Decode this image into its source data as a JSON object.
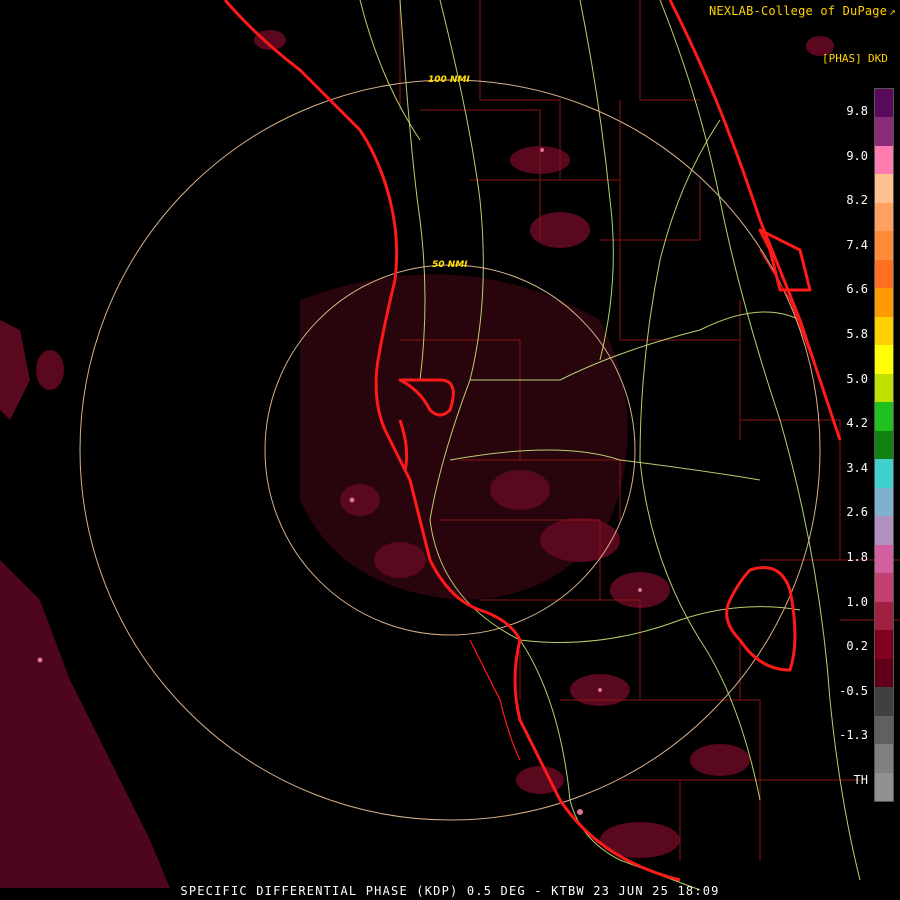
{
  "header": {
    "credit": "NEXLAB-College of DuPage",
    "credit_icon": "external-link-icon"
  },
  "legend": {
    "unit": "[PHAS]",
    "title": "DKD",
    "ticks": [
      "9.8",
      "9.0",
      "8.2",
      "7.4",
      "6.6",
      "5.8",
      "5.0",
      "4.2",
      "3.4",
      "2.6",
      "1.8",
      "1.0",
      "0.2",
      "-0.5",
      "-1.3",
      "TH"
    ],
    "colors": [
      "#5a0a5a",
      "#8c2a7a",
      "#ff7bb0",
      "#ffc090",
      "#ffa060",
      "#ff8a3a",
      "#ff7020",
      "#ff9a00",
      "#ffd000",
      "#ffff00",
      "#c0e000",
      "#20c020",
      "#108010",
      "#40d0d0",
      "#80b0d0",
      "#b090c0",
      "#d060a0",
      "#c04070",
      "#a02040",
      "#800020",
      "#600018",
      "#404040",
      "#606060",
      "#808080",
      "#909090"
    ]
  },
  "rings": {
    "inner_label": "50 NMI",
    "outer_label": "100 NMI"
  },
  "footer": {
    "caption": "SPECIFIC DIFFERENTIAL PHASE (KDP) 0.5 DEG - KTBW 23 JUN 25 18:09"
  },
  "colors": {
    "coast": "#ff1a1a",
    "roads": "#d4f07a",
    "counties": "#8a1414",
    "rings": "#d8b08a",
    "echo": "#7a0a2a"
  }
}
